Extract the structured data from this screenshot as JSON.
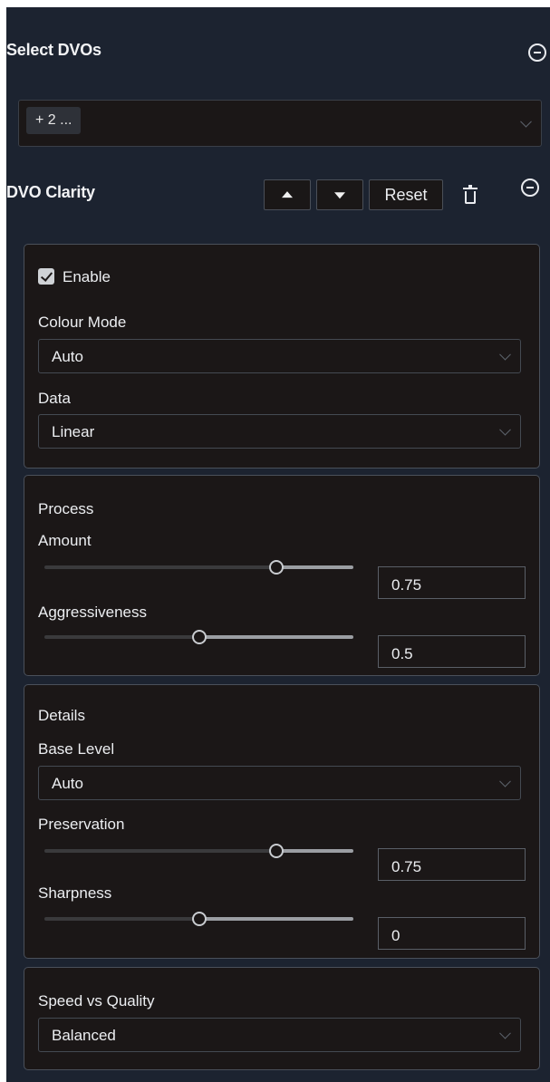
{
  "header": {
    "title": "Select DVOs"
  },
  "dvo_select": {
    "chip_label": "+ 2 ..."
  },
  "effect": {
    "title": "DVO Clarity",
    "reset_label": "Reset"
  },
  "enable_group": {
    "enable_label": "Enable",
    "enable_checked": true,
    "colour_mode_label": "Colour Mode",
    "colour_mode_value": "Auto",
    "data_label": "Data",
    "data_value": "Linear"
  },
  "process": {
    "section_label": "Process",
    "amount_label": "Amount",
    "amount_value": "0.75",
    "amount_fraction": 0.75,
    "aggressiveness_label": "Aggressiveness",
    "aggressiveness_value": "0.5",
    "aggressiveness_fraction": 0.5
  },
  "details": {
    "section_label": "Details",
    "base_level_label": "Base Level",
    "base_level_value": "Auto",
    "preservation_label": "Preservation",
    "preservation_value": "0.75",
    "preservation_fraction": 0.75,
    "sharpness_label": "Sharpness",
    "sharpness_value": "0",
    "sharpness_fraction": 0.5
  },
  "speed": {
    "label": "Speed vs Quality",
    "value": "Balanced"
  }
}
